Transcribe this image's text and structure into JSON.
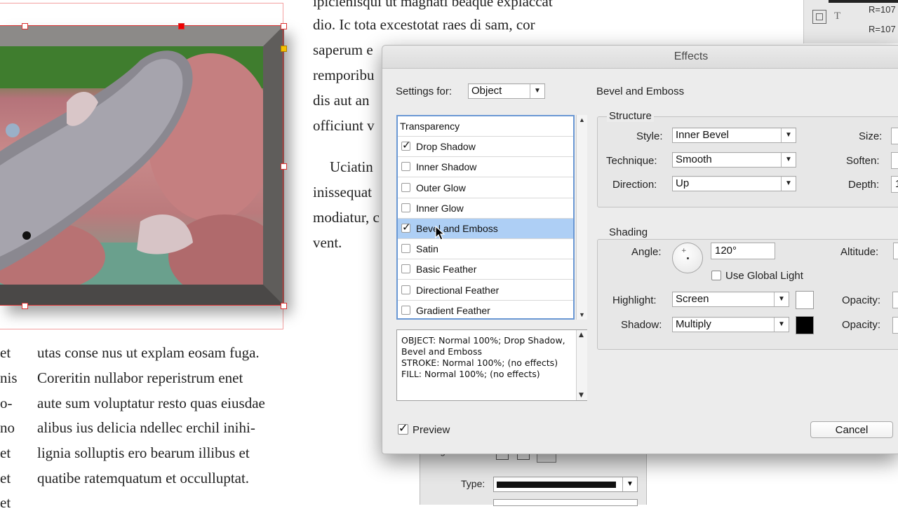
{
  "document": {
    "top_lines": [
      "ipicienisqui ut magnati beaque explaccat",
      "dio. Ic tota excestotat raes di sam, cor",
      "saperum e",
      "remporibu",
      "dis aut an",
      "officiunt v"
    ],
    "mid_lines": [
      "Uciatin",
      "inissequat",
      "modiatur, c",
      "vent."
    ],
    "left_fragments": [
      "et",
      "nis",
      "o-",
      "no",
      "et",
      "et",
      "et"
    ],
    "bottom_lines": [
      "utas conse nus ut explam eosam fuga.",
      "Coreritin nullabor reperistrum enet",
      "aute sum voluptatur resto quas eiusdae",
      "alibus ius delicia ndellec erchil inihi-",
      "lignia solluptis ero bearum illibus et",
      "quatibe ratemquatum et occulluptat."
    ]
  },
  "right_panel": {
    "r1": "R=107",
    "r2": "R=107",
    "t_glyph": "T"
  },
  "stroke_panel": {
    "align_label": "Align Stroke:",
    "type_label": "Type:"
  },
  "dialog": {
    "title": "Effects",
    "settings_for_label": "Settings for:",
    "settings_for_value": "Object",
    "section_title": "Bevel and Emboss",
    "effects": [
      {
        "label": "Transparency",
        "checkbox": false,
        "checked": false,
        "selected": false
      },
      {
        "label": "Drop Shadow",
        "checkbox": true,
        "checked": true,
        "selected": false
      },
      {
        "label": "Inner Shadow",
        "checkbox": true,
        "checked": false,
        "selected": false
      },
      {
        "label": "Outer Glow",
        "checkbox": true,
        "checked": false,
        "selected": false
      },
      {
        "label": "Inner Glow",
        "checkbox": true,
        "checked": false,
        "selected": false
      },
      {
        "label": "Bevel and Emboss",
        "checkbox": true,
        "checked": true,
        "selected": true
      },
      {
        "label": "Satin",
        "checkbox": true,
        "checked": false,
        "selected": false
      },
      {
        "label": "Basic Feather",
        "checkbox": true,
        "checked": false,
        "selected": false
      },
      {
        "label": "Directional Feather",
        "checkbox": true,
        "checked": false,
        "selected": false
      },
      {
        "label": "Gradient Feather",
        "checkbox": true,
        "checked": false,
        "selected": false
      }
    ],
    "summary": "OBJECT: Normal 100%; Drop Shadow,\nBevel and Emboss\nSTROKE: Normal 100%; (no effects)\nFILL: Normal 100%; (no effects)",
    "structure": {
      "title": "Structure",
      "style_label": "Style:",
      "style_value": "Inner Bevel",
      "technique_label": "Technique:",
      "technique_value": "Smooth",
      "direction_label": "Direction:",
      "direction_value": "Up",
      "size_label": "Size:",
      "soften_label": "Soften:",
      "depth_label": "Depth:",
      "depth_value": "1"
    },
    "shading": {
      "title": "Shading",
      "angle_label": "Angle:",
      "angle_value": "120°",
      "altitude_label": "Altitude:",
      "global_light_label": "Use Global Light",
      "highlight_label": "Highlight:",
      "highlight_value": "Screen",
      "shadow_label": "Shadow:",
      "shadow_value": "Multiply",
      "opacity_label": "Opacity:",
      "highlight_color": "#ffffff",
      "shadow_color": "#000000"
    },
    "preview_label": "Preview",
    "preview_checked": true,
    "cancel_label": "Cancel"
  }
}
